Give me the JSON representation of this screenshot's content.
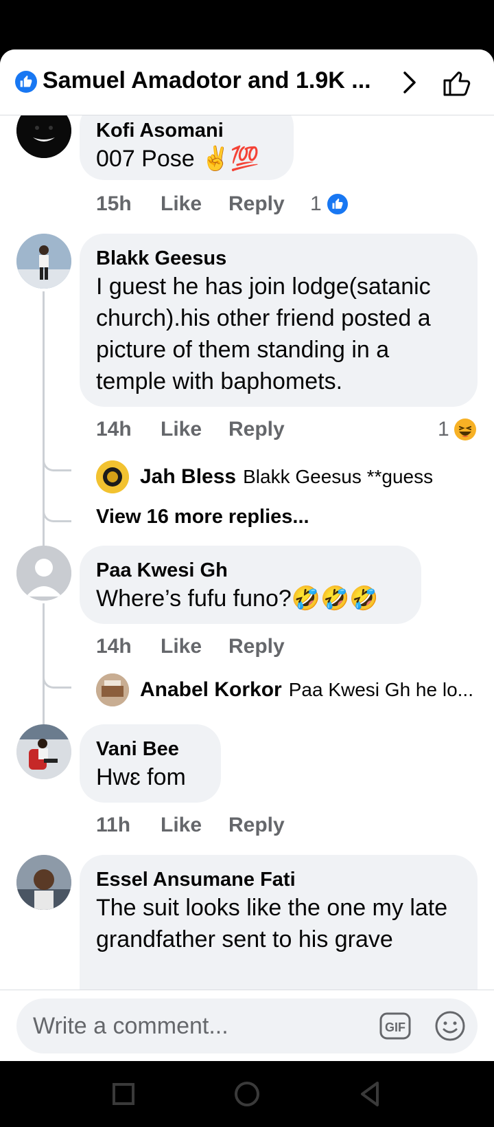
{
  "header": {
    "title": "Samuel Amadotor and 1.9K ..."
  },
  "comments": [
    {
      "name": "Kofi Asomani",
      "text": "007 Pose ✌️💯",
      "time": "15h",
      "like": "Like",
      "reply": "Reply",
      "reaction_count": "1"
    },
    {
      "name": "Blakk Geesus",
      "text": "I guest he has join lodge(satanic church).his other friend posted a picture of them standing in a temple with baphomets.",
      "time": "14h",
      "like": "Like",
      "reply": "Reply",
      "reaction_count": "1",
      "replies": [
        {
          "name": "Jah Bless",
          "text": "Blakk Geesus **guess"
        }
      ],
      "more_replies": "View 16 more replies..."
    },
    {
      "name": "Paa Kwesi Gh",
      "text": "Where’s fufu funo?🤣🤣🤣",
      "time": "14h",
      "like": "Like",
      "reply": "Reply",
      "replies": [
        {
          "name": "Anabel Korkor",
          "text": "Paa Kwesi Gh he lo..."
        }
      ]
    },
    {
      "name": "Vani Bee",
      "text": "Hwɛ fom",
      "time": "11h",
      "like": "Like",
      "reply": "Reply"
    },
    {
      "name": "Essel Ansumane Fati",
      "text": "The suit looks like the one my late grandfather sent to his grave"
    }
  ],
  "composer": {
    "placeholder": "Write a comment..."
  },
  "colors": {
    "accent": "#1877f2",
    "bubble": "#f0f2f5",
    "meta": "#65676b"
  }
}
